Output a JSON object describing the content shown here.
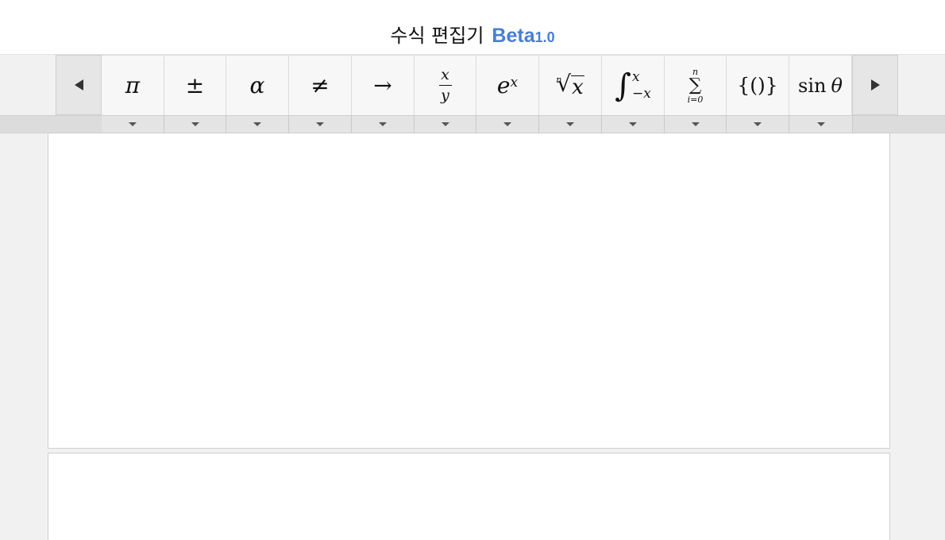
{
  "header": {
    "title": "수식 편집기",
    "beta": "Beta",
    "version": "1.0"
  },
  "colors": {
    "accent": "#4a7dd4"
  },
  "toolbar": {
    "prev_icon": "triangle-left-icon",
    "next_icon": "triangle-right-icon",
    "tools": {
      "pi": "π",
      "plusminus": "±",
      "alpha": "α",
      "notequal": "≠",
      "arrow": "→",
      "frac_num": "x",
      "frac_den": "y",
      "exp_base": "e",
      "exp_sup": "x",
      "root_index": "n",
      "root_symbol": "√",
      "root_arg": "x",
      "int_symbol": "∫",
      "int_upper": "x",
      "int_lower": "−x",
      "sum_upper": "n",
      "sum_symbol": "∑",
      "sum_lower": "i=0",
      "brackets": "{()}",
      "trig": "sin",
      "trig_arg": "θ"
    }
  }
}
